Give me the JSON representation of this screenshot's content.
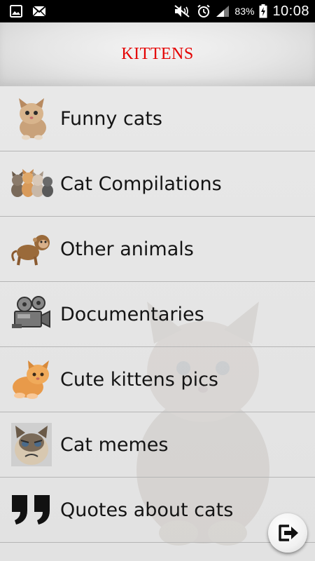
{
  "status_bar": {
    "icons_left": [
      "gallery-icon",
      "mail-icon"
    ],
    "icons_right": [
      "mute-icon",
      "alarm-icon",
      "signal-icon",
      "battery-icon"
    ],
    "battery": "83%",
    "time": "10:08"
  },
  "header": {
    "title": "KITTENS",
    "title_color": "#e40000"
  },
  "menu": {
    "items": [
      {
        "label": "Funny cats",
        "icon": "kitten-icon"
      },
      {
        "label": "Cat Compilations",
        "icon": "kittens-group-icon"
      },
      {
        "label": "Other animals",
        "icon": "monkey-icon"
      },
      {
        "label": "Documentaries",
        "icon": "video-camera-icon"
      },
      {
        "label": "Cute kittens pics",
        "icon": "orange-kitten-icon"
      },
      {
        "label": "Cat memes",
        "icon": "grumpy-cat-icon"
      },
      {
        "label": "Quotes about cats",
        "icon": "quote-icon"
      }
    ]
  },
  "fab": {
    "icon": "exit-icon"
  }
}
